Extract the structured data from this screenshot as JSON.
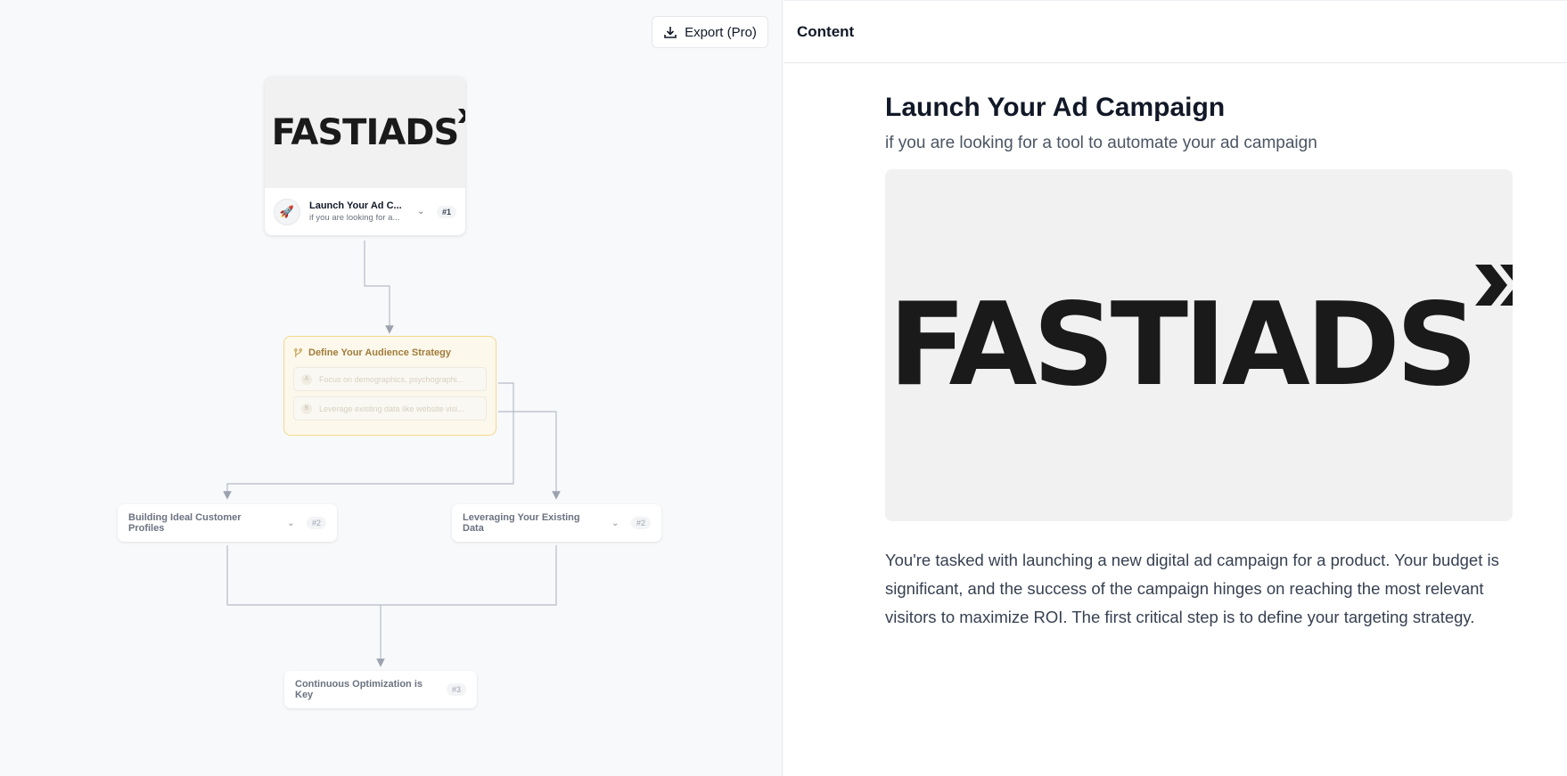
{
  "canvas": {
    "export_label": "Export (Pro)",
    "root_node": {
      "logo_text": "FASTIADS",
      "title": "Launch Your Ad C...",
      "subtitle": "if you are looking for a...",
      "badge": "#1",
      "icon": "rocket-icon"
    },
    "strategy_node": {
      "title": "Define Your Audience Strategy",
      "icon": "branch-icon",
      "options": [
        {
          "letter": "A",
          "text": "Focus on demographics, psychographi..."
        },
        {
          "letter": "B",
          "text": "Leverage existing data like website visi..."
        }
      ]
    },
    "child_nodes": [
      {
        "title": "Building Ideal Customer Profiles",
        "badge": "#2"
      },
      {
        "title": "Leveraging Your Existing Data",
        "badge": "#2"
      },
      {
        "title": "Continuous Optimization is Key",
        "badge": "#3"
      }
    ]
  },
  "panel": {
    "header": "Content",
    "title": "Launch Your Ad Campaign",
    "subtitle": "if you are looking for a tool to automate your ad campaign",
    "hero_logo_text": "FASTIADS",
    "body": "You're tasked with launching a new digital ad campaign for a product. Your budget is significant, and the success of the campaign hinges on reaching the most relevant visitors to maximize ROI. The first critical step is to define your targeting strategy."
  },
  "colors": {
    "strategy_border": "#f3d98b",
    "strategy_bg": "#fdf8ec",
    "connector": "#9ca3af"
  }
}
